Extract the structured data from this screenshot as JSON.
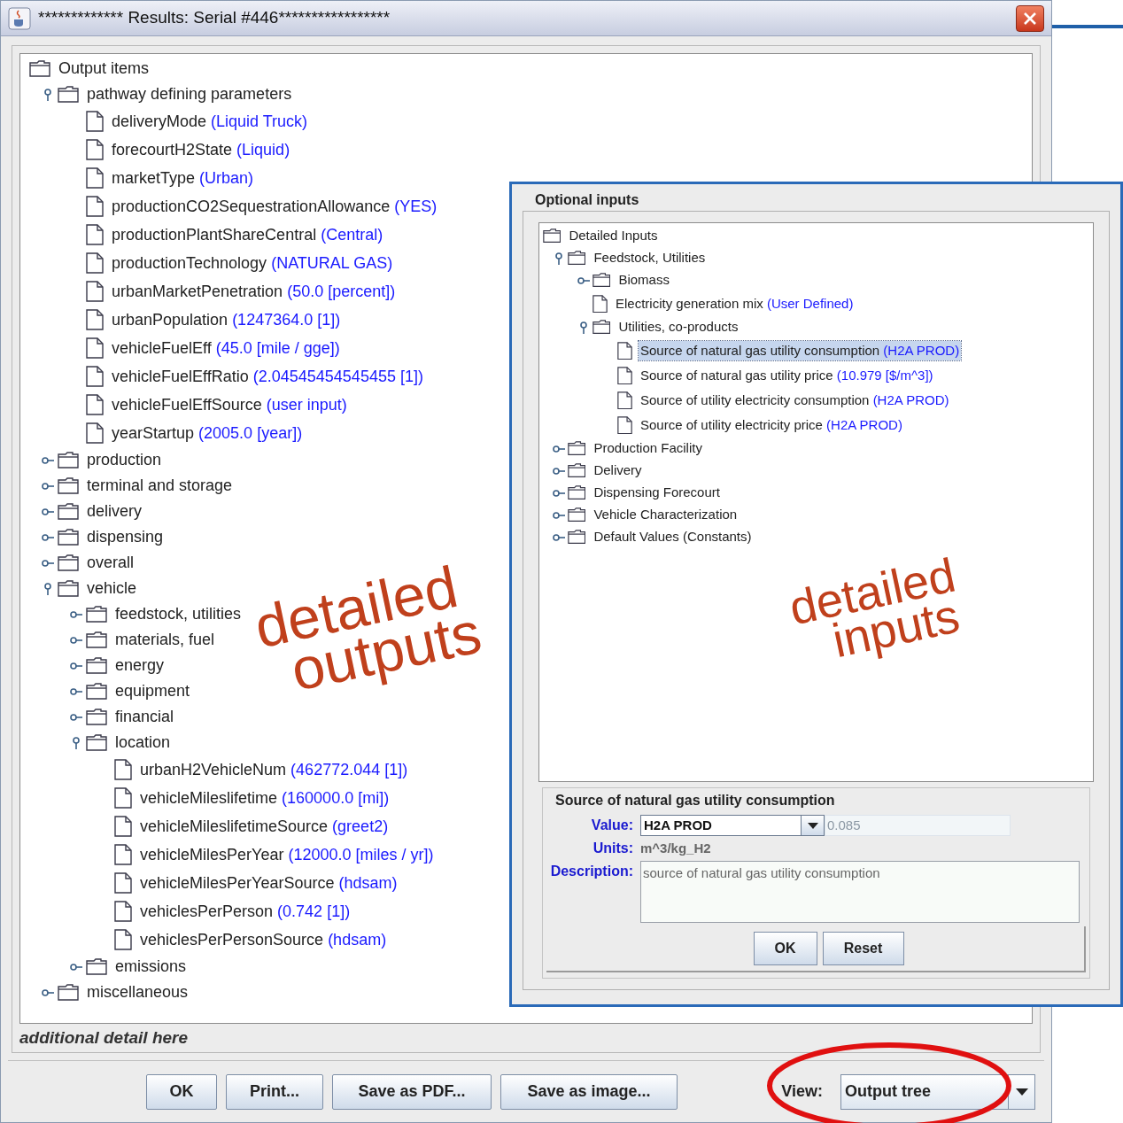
{
  "window": {
    "title": "************* Results: Serial #446*****************"
  },
  "output_tree": {
    "items": [
      {
        "kind": "folder",
        "label": "Output items",
        "children": [
          {
            "kind": "folder",
            "label": "pathway defining parameters",
            "expanded": true,
            "children": [
              {
                "kind": "file",
                "label": "deliveryMode",
                "value": "(Liquid Truck)"
              },
              {
                "kind": "file",
                "label": "forecourtH2State",
                "value": "(Liquid)"
              },
              {
                "kind": "file",
                "label": "marketType",
                "value": "(Urban)"
              },
              {
                "kind": "file",
                "label": "productionCO2SequestrationAllowance",
                "value": "(YES)"
              },
              {
                "kind": "file",
                "label": "productionPlantShareCentral",
                "value": "(Central)"
              },
              {
                "kind": "file",
                "label": "productionTechnology",
                "value": "(NATURAL GAS)"
              },
              {
                "kind": "file",
                "label": "urbanMarketPenetration",
                "value": "(50.0 [percent])"
              },
              {
                "kind": "file",
                "label": "urbanPopulation",
                "value": "(1247364.0 [1])"
              },
              {
                "kind": "file",
                "label": "vehicleFuelEff",
                "value": "(45.0 [mile / gge])"
              },
              {
                "kind": "file",
                "label": "vehicleFuelEffRatio",
                "value": "(2.04545454545455 [1])"
              },
              {
                "kind": "file",
                "label": "vehicleFuelEffSource",
                "value": "(user input)"
              },
              {
                "kind": "file",
                "label": "yearStartup",
                "value": "(2005.0 [year])"
              }
            ]
          },
          {
            "kind": "folder",
            "label": "production",
            "expanded": false
          },
          {
            "kind": "folder",
            "label": "terminal and storage",
            "expanded": false
          },
          {
            "kind": "folder",
            "label": "delivery",
            "expanded": false
          },
          {
            "kind": "folder",
            "label": "dispensing",
            "expanded": false
          },
          {
            "kind": "folder",
            "label": "overall",
            "expanded": false
          },
          {
            "kind": "folder",
            "label": "vehicle",
            "expanded": true,
            "children": [
              {
                "kind": "folder",
                "label": "feedstock, utilities",
                "expanded": false
              },
              {
                "kind": "folder",
                "label": "materials, fuel",
                "expanded": false
              },
              {
                "kind": "folder",
                "label": "energy",
                "expanded": false
              },
              {
                "kind": "folder",
                "label": "equipment",
                "expanded": false
              },
              {
                "kind": "folder",
                "label": "financial",
                "expanded": false
              },
              {
                "kind": "folder",
                "label": "location",
                "expanded": true,
                "children": [
                  {
                    "kind": "file",
                    "label": "urbanH2VehicleNum",
                    "value": "(462772.044 [1])"
                  },
                  {
                    "kind": "file",
                    "label": "vehicleMileslifetime",
                    "value": "(160000.0 [mi])"
                  },
                  {
                    "kind": "file",
                    "label": "vehicleMileslifetimeSource",
                    "value": "(greet2)"
                  },
                  {
                    "kind": "file",
                    "label": "vehicleMilesPerYear",
                    "value": "(12000.0 [miles / yr])"
                  },
                  {
                    "kind": "file",
                    "label": "vehicleMilesPerYearSource",
                    "value": "(hdsam)"
                  },
                  {
                    "kind": "file",
                    "label": "vehiclesPerPerson",
                    "value": "(0.742 [1])"
                  },
                  {
                    "kind": "file",
                    "label": "vehiclesPerPersonSource",
                    "value": "(hdsam)"
                  }
                ]
              },
              {
                "kind": "folder",
                "label": "emissions",
                "expanded": false
              }
            ]
          },
          {
            "kind": "folder",
            "label": "miscellaneous",
            "expanded": false
          }
        ]
      }
    ]
  },
  "detail_text": "additional detail here",
  "buttons": [
    "OK",
    "Print...",
    "Save as PDF...",
    "Save as image..."
  ],
  "view": {
    "label": "View:",
    "value": "Output tree"
  },
  "optional_inputs": {
    "title": "Optional inputs",
    "tree": {
      "items": [
        {
          "kind": "folder",
          "label": "Detailed Inputs",
          "children": [
            {
              "kind": "folder",
              "label": "Feedstock, Utilities",
              "expanded": true,
              "children": [
                {
                  "kind": "folder",
                  "label": "Biomass",
                  "expanded": false
                },
                {
                  "kind": "file",
                  "label": "Electricity generation mix",
                  "value": "(User Defined)",
                  "selected": false
                },
                {
                  "kind": "folder",
                  "label": "Utilities, co-products",
                  "expanded": true,
                  "children": [
                    {
                      "kind": "file",
                      "label": "Source of natural gas utility consumption",
                      "value": "(H2A PROD)",
                      "selected": true
                    },
                    {
                      "kind": "file",
                      "label": "Source of natural gas utility price",
                      "value": "(10.979 [$/m^3])",
                      "selected": false
                    },
                    {
                      "kind": "file",
                      "label": "Source of utility electricity consumption",
                      "value": "(H2A PROD)",
                      "selected": false
                    },
                    {
                      "kind": "file",
                      "label": "Source of utility electricity price",
                      "value": "(H2A PROD)",
                      "selected": false
                    }
                  ]
                }
              ]
            },
            {
              "kind": "folder",
              "label": "Production Facility",
              "expanded": false
            },
            {
              "kind": "folder",
              "label": "Delivery",
              "expanded": false
            },
            {
              "kind": "folder",
              "label": "Dispensing Forecourt",
              "expanded": false
            },
            {
              "kind": "folder",
              "label": "Vehicle Characterization",
              "expanded": false
            },
            {
              "kind": "folder",
              "label": "Default Values (Constants)",
              "expanded": false
            }
          ]
        }
      ]
    },
    "detail": {
      "title": "Source of natural gas utility consumption",
      "fields": [
        {
          "kind": "combo",
          "label": "Value:",
          "value": "H2A PROD",
          "number": "0.085",
          "number_disabled": true
        },
        {
          "kind": "text",
          "label": "Units:",
          "value": "m^3/kg_H2"
        },
        {
          "kind": "textarea",
          "label": "Description:",
          "value": "source of natural gas utility consumption"
        }
      ],
      "buttons": [
        "OK",
        "Reset"
      ]
    }
  },
  "annotations": [
    {
      "lines": [
        "detailed",
        "outputs"
      ]
    },
    {
      "lines": [
        "detailed",
        "inputs"
      ]
    }
  ]
}
